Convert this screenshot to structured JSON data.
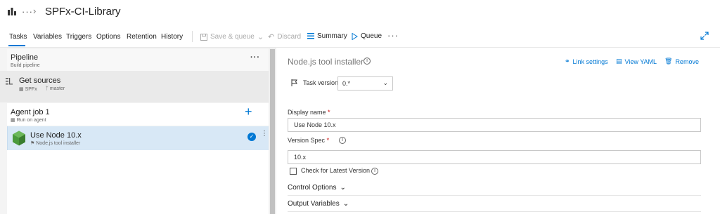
{
  "header": {
    "project_icon": "organization-icon",
    "ellipsis": "···",
    "chevron": "›",
    "pipeline_name": "SPFx-CI-Library"
  },
  "tabs": [
    {
      "label": "Tasks",
      "active": true
    },
    {
      "label": "Variables"
    },
    {
      "label": "Triggers"
    },
    {
      "label": "Options"
    },
    {
      "label": "Retention"
    },
    {
      "label": "History"
    }
  ],
  "toolbar": {
    "save_queue": "Save & queue",
    "discard": "Discard",
    "summary": "Summary",
    "queue": "Queue",
    "more": "···"
  },
  "left": {
    "pipeline_title": "Pipeline",
    "pipeline_sub": "Build pipeline",
    "pipeline_more": "···",
    "get_sources": {
      "title": "Get sources",
      "repo": "SPFx",
      "branch": "master"
    },
    "agent_job": {
      "title": "Agent job 1",
      "sub": "Run on agent",
      "add": "+"
    },
    "task": {
      "title": "Use Node 10.x",
      "sub": "Node.js tool installer",
      "check": "✓"
    }
  },
  "right": {
    "title": "Node.js tool installer",
    "links": {
      "link_settings": "Link settings",
      "view_yaml": "View YAML",
      "remove": "Remove"
    },
    "task_version_label": "Task version",
    "task_version_value": "0.*",
    "display_name_label": "Display name",
    "display_name_value": "Use Node 10.x",
    "version_spec_label": "Version Spec",
    "version_spec_value": "10.x",
    "required_mark": "*",
    "check_latest_label": "Check for Latest Version",
    "check_latest_checked": false,
    "control_options": "Control Options",
    "output_variables": "Output Variables",
    "info_glyph": "i"
  },
  "colors": {
    "accent": "#0078d4",
    "selected_row": "#d8e8f6",
    "node_green": "#4a9a3c",
    "required": "#cc0000"
  }
}
